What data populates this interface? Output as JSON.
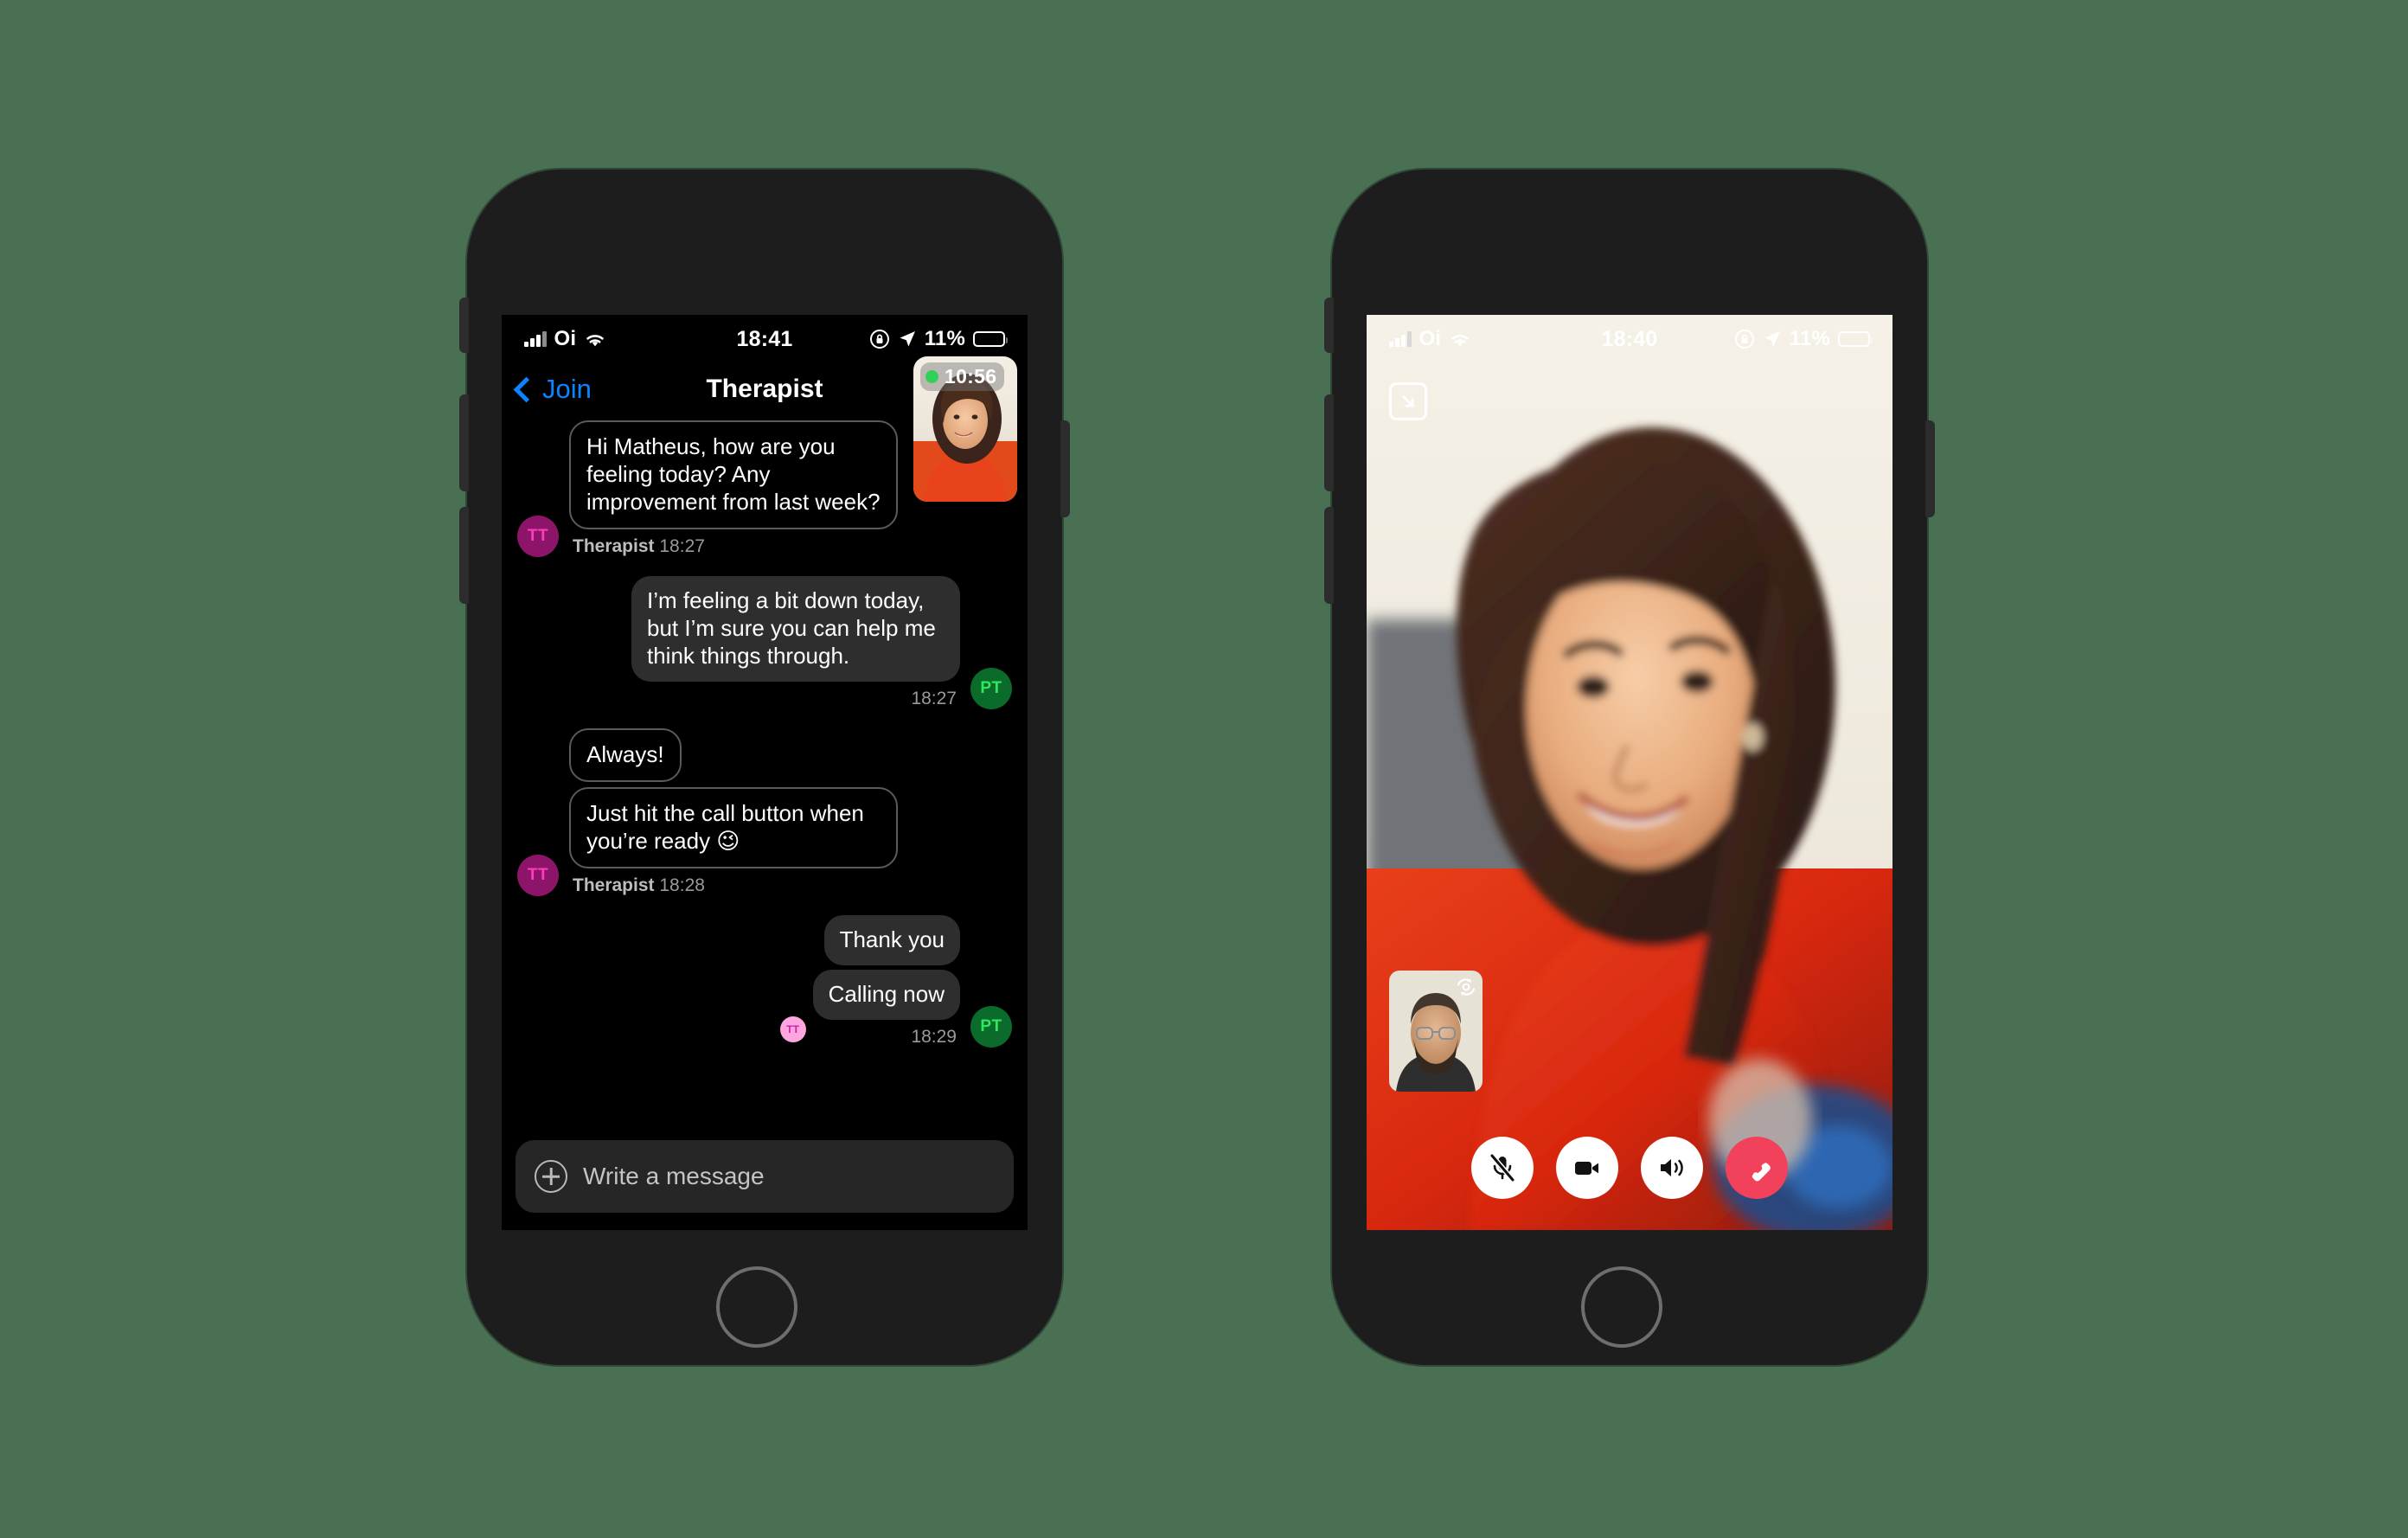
{
  "background_color": "#4a7053",
  "phone_left": {
    "name": "chat-phone",
    "status_bar": {
      "carrier": "Oi",
      "time": "18:41",
      "battery_percent": "11%",
      "icons": [
        "signal-bars-icon",
        "wifi-icon",
        "orientation-lock-icon",
        "location-arrow-icon",
        "battery-icon"
      ]
    },
    "nav": {
      "back_label": "Join",
      "title": "Therapist"
    },
    "call_pip": {
      "timer": "10:56",
      "status": "active"
    },
    "messages": [
      {
        "id": "m1",
        "direction": "in",
        "sender": "Therapist",
        "time": "18:27",
        "avatar": "TT",
        "style": "outline",
        "text": "Hi Matheus, how are you feeling today? Any improvement from last week?"
      },
      {
        "id": "m2",
        "direction": "out",
        "sender": "",
        "time": "18:27",
        "avatar": "PT",
        "style": "filled",
        "text": "I’m feeling a bit down today, but I’m sure you can help me think things through."
      },
      {
        "id": "m3",
        "direction": "in",
        "sender": "Therapist",
        "time": "18:28",
        "avatar": "TT",
        "style": "outline",
        "text": "Always!"
      },
      {
        "id": "m4",
        "direction": "in",
        "sender": "Therapist",
        "time": "18:28",
        "avatar": "TT",
        "style": "outline",
        "text": "Just hit the call button when you’re ready 😉"
      },
      {
        "id": "m5",
        "direction": "out",
        "sender": "",
        "time": "18:29",
        "avatar": "PT",
        "style": "filled",
        "text": "Thank you"
      },
      {
        "id": "m6",
        "direction": "out",
        "sender": "",
        "time": "18:29",
        "avatar": "PT",
        "read_by": "TT",
        "style": "filled",
        "text": "Calling now"
      }
    ],
    "composer": {
      "placeholder": "Write a message",
      "attach_icon": "plus-circle-icon"
    },
    "home_button": "home-button"
  },
  "phone_right": {
    "name": "video-call-phone",
    "status_bar": {
      "carrier": "Oi",
      "time": "18:40",
      "battery_percent": "11%",
      "icons": [
        "signal-bars-icon",
        "wifi-icon",
        "orientation-lock-icon",
        "location-arrow-icon",
        "battery-icon"
      ]
    },
    "minimize_icon": "minimize-arrow-icon",
    "self_view": {
      "flip_icon": "camera-flip-icon"
    },
    "controls": [
      {
        "name": "mute-mic-button",
        "icon": "microphone-muted-icon",
        "style": "light"
      },
      {
        "name": "video-toggle-button",
        "icon": "video-camera-icon",
        "style": "light"
      },
      {
        "name": "speaker-button",
        "icon": "speaker-icon",
        "style": "light"
      },
      {
        "name": "end-call-button",
        "icon": "hang-up-icon",
        "style": "danger"
      }
    ],
    "home_button": "home-button"
  },
  "colors": {
    "accent_blue": "#0a84ff",
    "status_green": "#30d158",
    "end_call_red": "#f2415a",
    "battery_red": "#ff3b30",
    "avatar_tt_bg": "#8d1569",
    "avatar_tt_fg": "#ff3bbd",
    "avatar_pt_bg": "#0b6b2b",
    "avatar_pt_fg": "#2ee85e"
  }
}
